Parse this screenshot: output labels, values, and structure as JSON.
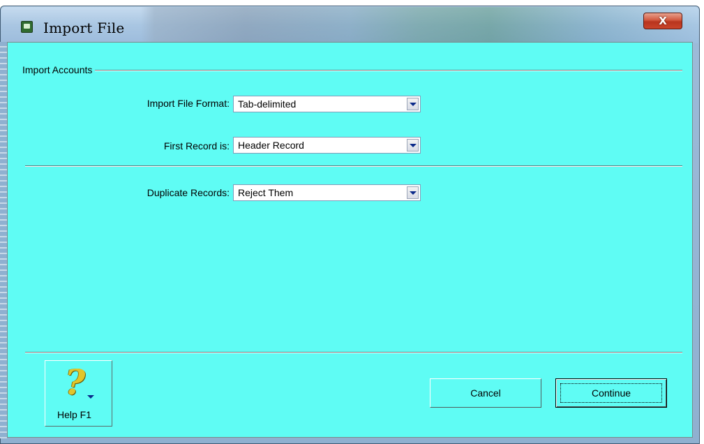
{
  "window": {
    "title": "Import File",
    "close_label": "X"
  },
  "group": {
    "label": "Import Accounts"
  },
  "fields": {
    "import_format": {
      "label": "Import File Format:",
      "value": "Tab-delimited"
    },
    "first_record": {
      "label": "First Record is:",
      "value": "Header Record"
    },
    "duplicates": {
      "label": "Duplicate Records:",
      "value": "Reject Them"
    }
  },
  "buttons": {
    "help_label": "Help F1",
    "help_glyph": "?",
    "cancel_label": "Cancel",
    "continue_label": "Continue"
  },
  "icons": {
    "app": "app-window-icon",
    "close": "close-icon",
    "help": "question-mark-icon",
    "dropdown": "chevron-down-icon"
  },
  "colors": {
    "client_background": "#5ffcf4",
    "close_button": "#c9432a"
  }
}
